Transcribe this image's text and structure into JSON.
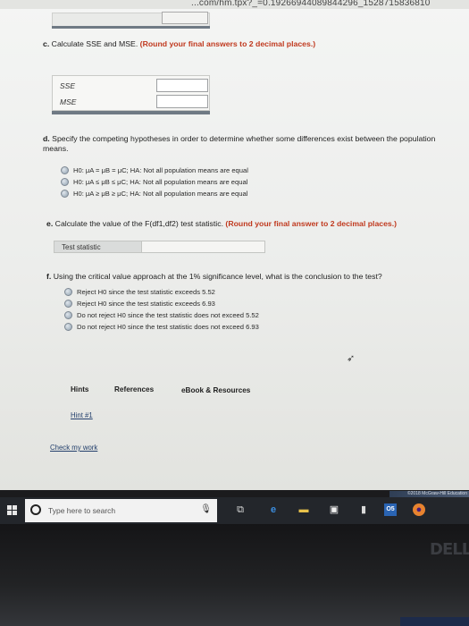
{
  "url_fragment": "...com/hm.tpx?_=0.19266944089844296_1528715836810",
  "part_c": {
    "letter": "c.",
    "text": "Calculate SSE and MSE.",
    "note": "(Round your final answers to 2 decimal places.)",
    "rows": [
      {
        "label": "SSE",
        "value": ""
      },
      {
        "label": "MSE",
        "value": ""
      }
    ]
  },
  "part_d": {
    "letter": "d.",
    "text": "Specify the competing hypotheses in order to determine whether some differences exist between the population means.",
    "options": [
      "H0: μA = μB = μC; HA: Not all population means are equal",
      "H0: μA ≤ μB ≤ μC; HA: Not all population means are equal",
      "H0: μA ≥ μB ≥ μC; HA: Not all population means are equal"
    ]
  },
  "part_e": {
    "letter": "e.",
    "text": "Calculate the value of the F(df1,df2) test statistic.",
    "note": "(Round your final answer to 2 decimal places.)",
    "stat_label": "Test statistic",
    "stat_value": ""
  },
  "part_f": {
    "letter": "f.",
    "text": "Using the critical value approach at the 1% significance level, what is the conclusion to the test?",
    "options": [
      "Reject H0 since the test statistic exceeds 5.52",
      "Reject H0 since the test statistic exceeds 6.93",
      "Do not reject H0 since the test statistic does not exceed 5.52",
      "Do not reject H0 since the test statistic does not exceed 6.93"
    ]
  },
  "tabs": {
    "hints": "Hints",
    "references": "References",
    "ebook": "eBook & Resources"
  },
  "hint_link": "Hint #1",
  "check_link": "Check my work",
  "promo_text": "©2018 McGraw-Hill Education",
  "taskbar": {
    "search_placeholder": "Type here to search",
    "icons": [
      "windows-icon",
      "search-icon",
      "mic-icon",
      "task-view-icon",
      "edge-icon",
      "file-explorer-icon",
      "store-icon",
      "office-icon",
      "firefox-icon"
    ]
  },
  "bezel": {
    "brand": "DELL"
  }
}
